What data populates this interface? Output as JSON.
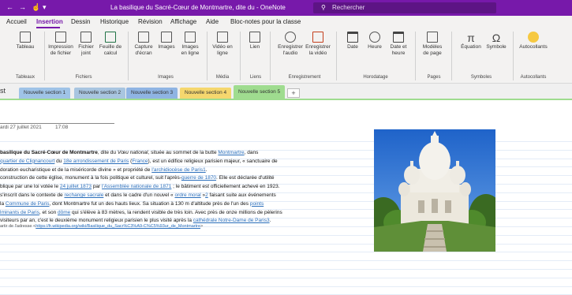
{
  "window": {
    "title": "La basilique du Sacré-Cœur de Montmartre, dite du  -  OneNote",
    "search_placeholder": "Rechercher"
  },
  "menu": {
    "tabs": [
      "Accueil",
      "Insertion",
      "Dessin",
      "Historique",
      "Révision",
      "Affichage",
      "Aide",
      "Bloc-notes pour la classe"
    ],
    "active": "Insertion"
  },
  "ribbon": {
    "buttons": {
      "tableau": "Tableau",
      "impression": "Impression de fichier",
      "fichier_joint": "Fichier joint",
      "feuille_calcul": "Feuille de calcul",
      "capture": "Capture d'écran",
      "images": "Images",
      "images_en_ligne": "Images en ligne",
      "video_en_ligne": "Vidéo en ligne",
      "lien": "Lien",
      "enr_audio": "Enregistrer l'audio",
      "enr_video": "Enregistrer la vidéo",
      "date": "Date",
      "heure": "Heure",
      "date_heure": "Date et heure",
      "modeles": "Modèles de page",
      "equation": "Équation",
      "symbole": "Symbole",
      "autocollants": "Autocollants"
    },
    "groups": [
      "Tableaux",
      "Fichiers",
      "Images",
      "Média",
      "Liens",
      "Enregistrement",
      "Horodatage",
      "Pages",
      "Symboles",
      "Autocollants"
    ],
    "icons": [
      "table-icon",
      "print-icon",
      "paperclip-icon",
      "excel-icon",
      "screenshot-icon",
      "picture-icon",
      "online-picture-icon",
      "online-video-icon",
      "link-icon",
      "microphone-icon",
      "video-record-icon",
      "calendar-icon",
      "clock-icon",
      "calendar-clock-icon",
      "page-template-icon",
      "pi-icon",
      "omega-icon",
      "sticker-icon"
    ]
  },
  "notebook": {
    "name": "st",
    "sections": [
      {
        "label": "Nouvelle section 1",
        "color": "#9fc3e7"
      },
      {
        "label": "Nouvelle section 2",
        "color": "#a8c5e0"
      },
      {
        "label": "Nouvelle section 3",
        "color": "#8fb4e3"
      },
      {
        "label": "Nouvelle section 4",
        "color": "#f5d76e"
      },
      {
        "label": "Nouvelle section 5",
        "color": "#9fdc8f"
      }
    ],
    "add_label": "+"
  },
  "page": {
    "date": "ardi 27 juillet 2021",
    "time": "17:08",
    "lines": [
      [
        {
          "t": "basilique du Sacré-Cœur de Montmartre",
          "b": true
        },
        {
          "t": ", dite du "
        },
        {
          "t": "Vœu national",
          "i": true
        },
        {
          "t": ", située au sommet de la butte "
        },
        {
          "t": "Montmartre",
          "l": true
        },
        {
          "t": ", dans"
        }
      ],
      [
        {
          "t": "quartier de Clignancourt",
          "l": true
        },
        {
          "t": " du "
        },
        {
          "t": "18e arrondissement de Paris",
          "l": true
        },
        {
          "t": " ("
        },
        {
          "t": "France",
          "l": true
        },
        {
          "t": "), est un édifice religieux parisien majeur, « sanctuaire de"
        }
      ],
      [
        {
          "t": "doration eucharistique et de la miséricorde divine » et propriété de "
        },
        {
          "t": "l'archidiocèse de Paris",
          "l": true
        },
        {
          "t": "1",
          "l": true
        },
        {
          "t": "."
        }
      ],
      [
        {
          "t": " construction de cette église, monument à la fois politique et culturel, suit l'après-"
        },
        {
          "t": "guerre de 1870",
          "l": true
        },
        {
          "t": ". Elle est déclarée d'utilité"
        }
      ],
      [
        {
          "t": "blique par une loi votée le "
        },
        {
          "t": "24 juillet 1873",
          "l": true
        },
        {
          "t": " par "
        },
        {
          "t": "l'Assemblée nationale de 1871",
          "l": true
        },
        {
          "t": " ; le bâtiment est officiellement achevé en 1923."
        }
      ],
      [
        {
          "t": " s'inscrit dans le contexte de "
        },
        {
          "t": "rechange sacrale",
          "l": true
        },
        {
          "t": " et dans le cadre d'un nouvel « "
        },
        {
          "t": "ordre moral",
          "l": true
        },
        {
          "t": " »"
        },
        {
          "t": "2",
          "l": true
        },
        {
          "t": " faisant suite aux événements"
        }
      ],
      [
        {
          "t": " la "
        },
        {
          "t": "Commune de Paris",
          "l": true
        },
        {
          "t": ", dont Montmartre fut un des hauts lieux. Sa situation à 130 m d'altitude près de l'un des "
        },
        {
          "t": "points",
          "l": true
        }
      ],
      [
        {
          "t": "lminants de Paris",
          "l": true
        },
        {
          "t": ", et son "
        },
        {
          "t": "dôme",
          "l": true
        },
        {
          "t": " qui s'élève à 83 mètres, la rendent visible de très loin. Avec près de onze millions de pèlerins"
        }
      ],
      [
        {
          "t": " visiteurs par an, c'est le deuxième monument religieux parisien le plus visité après la "
        },
        {
          "t": "cathédrale Notre-Dame de Paris",
          "l": true
        },
        {
          "t": "3",
          "l": true
        },
        {
          "t": "."
        }
      ]
    ],
    "source_prefix": "artir de l'adresse <",
    "source_url": "https://fr.wikipedia.org/wiki/Basilique_du_Sacr%C3%A9-C%C5%93ur_de_Montmartre",
    "source_suffix": ">",
    "photo": "sacre-coeur-photo"
  }
}
